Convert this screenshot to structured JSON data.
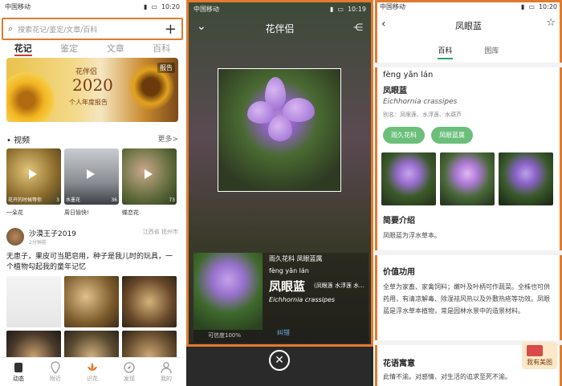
{
  "panel1": {
    "status": {
      "carrier": "中国移动",
      "time": "10:20"
    },
    "search_placeholder": "搜索花记/鉴定/文章/百科",
    "tabs": [
      "花记",
      "鉴定",
      "文章",
      "百科"
    ],
    "banner": {
      "brand": "花伴侣",
      "year": "2020",
      "subtitle": "个人年度报告",
      "badge": "报告"
    },
    "videos_title": "• 视频",
    "videos_more": "更多>",
    "videos": [
      {
        "caption": "花开的时候等你",
        "count": "3",
        "label": "一朵花"
      },
      {
        "caption": "水墨花",
        "count": "36",
        "label": "周日愉快!"
      },
      {
        "caption": "",
        "count": "73",
        "label": "蝶恋花"
      }
    ],
    "user": {
      "name": "沙漠王子2019",
      "time": "2分钟前",
      "location": "江西省 抚州市"
    },
    "post_text": "无患子，果皮可当肥皂用，种子是我儿时的玩具，一个植物勾起我的童年记忆",
    "nav": [
      "动态",
      "附近",
      "识花",
      "发现",
      "我的"
    ]
  },
  "panel2": {
    "status": {
      "carrier": "中国移动",
      "time": "10:19"
    },
    "title": "花伴侣",
    "result": {
      "family": "雨久花科 凤眼蓝属",
      "pinyin": "fèng yǎn lán",
      "name": "凤眼蓝",
      "alias": "(凤眼莲 水浮莲 水...",
      "latin": "Eichhornia crassipes",
      "confidence": "可信度100%",
      "correct": "纠错"
    }
  },
  "panel3": {
    "status": {
      "carrier": "中国移动",
      "time": "10:20"
    },
    "title": "凤眼蓝",
    "tabs": [
      "百科",
      "图库"
    ],
    "pinyin": "fèng yǎn lán",
    "name": "凤眼蓝",
    "latin": "Eichhornia crassipes",
    "alias": "别名：凤眼莲、水浮莲、水葫芦",
    "tags": [
      "雨久花科",
      "凤眼蓝属"
    ],
    "intro_title": "简要介绍",
    "intro_text": "凤眼蓝为浮水草本。",
    "value_title": "价值功用",
    "value_text": "全草为家畜、家禽饲料；嫩叶及叶柄可作蔬菜。全株也可供药用，有清凉解毒、除湿祛风热以及外敷热疮等功效。凤眼蓝是浮水草本植物，常是园林水景中的造景材料。",
    "flower_title": "花语寓意",
    "flower_text": "此情不渝。对感情、对生活的追求至死不渝。",
    "badge": "我有美图"
  }
}
